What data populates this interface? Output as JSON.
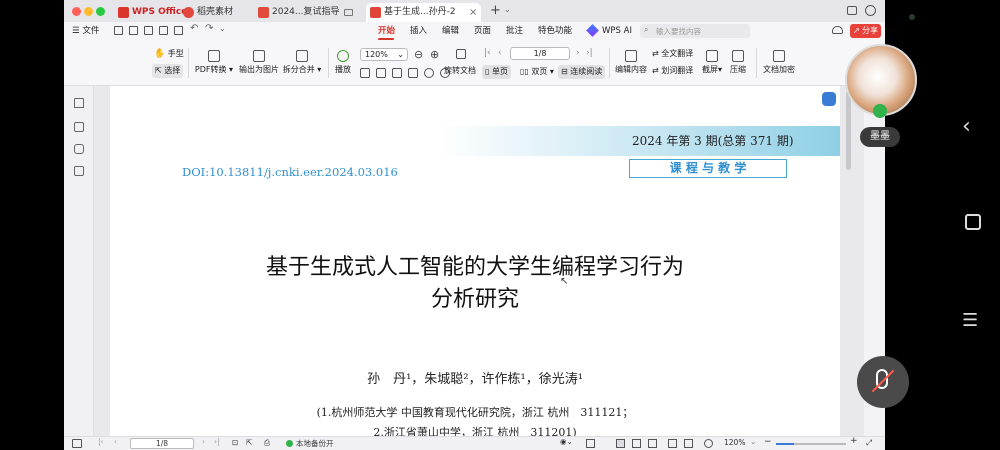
{
  "tabs": [
    {
      "label": "WPS Office",
      "color": "#d9352b"
    },
    {
      "label": "稻壳素材",
      "color": "#e2483d"
    },
    {
      "label": "2024...复试指导",
      "color": "#e14a3b"
    },
    {
      "label": "基于生成...孙丹-2",
      "color": "#e0453a"
    }
  ],
  "menu": {
    "file": "文件",
    "items": [
      "开始",
      "插入",
      "编辑",
      "页面",
      "批注",
      "特色功能"
    ],
    "active": "开始",
    "wps_ai": "WPS AI",
    "search_placeholder": "输入要找内容",
    "share": "分享"
  },
  "toolbar": {
    "hand": "手型",
    "select": "选择",
    "pdf_convert": "PDF转换",
    "export_image": "输出为图片",
    "split_merge": "拆分合并",
    "play": "播放",
    "zoom": "120%",
    "rotate_doc": "旋转文档",
    "page_current": "1/8",
    "single_page": "单页",
    "double_page": "双页",
    "continuous": "连续阅读",
    "edit_content": "编辑内容",
    "full_translate": "全文翻译",
    "word_translate": "划词翻译",
    "screenshot": "截屏",
    "compress": "压缩",
    "doc_encrypt": "文档加密"
  },
  "document": {
    "issue": "2024 年第 3 期(总第 371 期)",
    "doi": "DOI:10.13811/j.cnki.eer.2024.03.016",
    "column": "课 程 与 教 学",
    "title_line1": "基于生成式人工智能的大学生编程学习行为",
    "title_line2": "分析研究",
    "authors": "孙　丹¹，朱城聪²，许作栋¹，徐光涛¹",
    "affil1": "(1.杭州师范大学 中国教育现代化研究院，浙江 杭州　311121；",
    "affil2": "2.浙江省萧山中学，浙江 杭州　311201)"
  },
  "status": {
    "page": "1/8",
    "backup": "本地备份开",
    "zoom": "120%"
  },
  "side": {
    "user_name": "墨墨"
  }
}
